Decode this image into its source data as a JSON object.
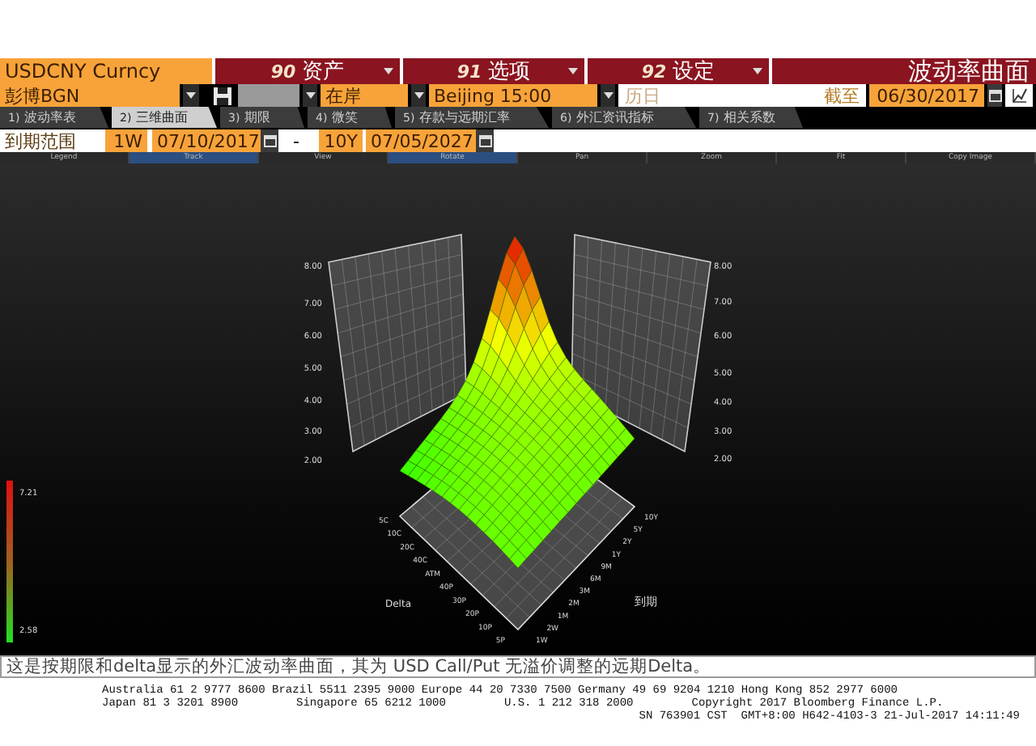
{
  "security": "USDCNY Curncy",
  "menus": [
    {
      "number": "90",
      "label": "资产"
    },
    {
      "number": "91",
      "label": "选项"
    },
    {
      "number": "92",
      "label": "设定"
    }
  ],
  "page_title": "波动率曲面",
  "settings": {
    "source": "彭博BGN",
    "market": "在岸",
    "time": "Beijing 15:00",
    "calendar": "历日",
    "as_of_label": "截至",
    "as_of_date": "06/30/2017"
  },
  "tabs": [
    {
      "number": "1)",
      "label": "波动率表",
      "selected": false
    },
    {
      "number": "2)",
      "label": "三维曲面",
      "selected": true
    },
    {
      "number": "3)",
      "label": "期限",
      "selected": false
    },
    {
      "number": "4)",
      "label": "微笑",
      "selected": false
    },
    {
      "number": "5)",
      "label": "存款与远期汇率",
      "selected": false
    },
    {
      "number": "6)",
      "label": "外汇资讯指标",
      "selected": false
    },
    {
      "number": "7)",
      "label": "相关系数",
      "selected": false
    }
  ],
  "expiry_range": {
    "label": "到期范围",
    "start_tenor": "1W",
    "start_date": "07/10/2017",
    "separator": "-",
    "end_tenor": "10Y",
    "end_date": "07/05/2027"
  },
  "toolbar": [
    {
      "label": "Legend",
      "selected": false
    },
    {
      "label": "Track",
      "selected": true
    },
    {
      "label": "View",
      "selected": false
    },
    {
      "label": "Rotate",
      "selected": true
    },
    {
      "label": "Pan",
      "selected": false
    },
    {
      "label": "Zoom",
      "selected": false
    },
    {
      "label": "Fit",
      "selected": false
    },
    {
      "label": "Copy Image",
      "selected": false
    }
  ],
  "chart": {
    "left_wall_ticks": [
      "8.00",
      "7.00",
      "6.00",
      "5.00",
      "4.00",
      "3.00",
      "2.00"
    ],
    "right_wall_ticks": [
      "8.00",
      "7.00",
      "6.00",
      "5.00",
      "4.00",
      "3.00",
      "2.00"
    ],
    "delta_ticks": [
      "5C",
      "10C",
      "20C",
      "40C",
      "ATM",
      "40P",
      "30P",
      "20P",
      "10P",
      "5P"
    ],
    "maturity_ticks": [
      "1W",
      "2W",
      "1M",
      "2M",
      "3M",
      "6M",
      "9M",
      "1Y",
      "2Y",
      "5Y",
      "10Y"
    ],
    "delta_title": "Delta",
    "maturity_title": "到期",
    "legend": {
      "max": "7.21",
      "min": "2.58"
    }
  },
  "description": "这是按期限和delta显示的外汇波动率曲面，其为 USD Call/Put 无溢价调整的远期Delta。",
  "footer": {
    "lines": [
      [
        "Australia 61 2 9777 8600 Brazil 5511 2395 9000 Europe 44 20 7330 7500 Germany 49 69 9204 1210 Hong Kong 852 2977 6000"
      ],
      [
        "Japan 81 3 3201 8900",
        "Singapore 65 6212 1000",
        "U.S. 1 212 318 2000",
        "Copyright 2017 Bloomberg Finance L.P."
      ],
      [
        "SN 763901 CST  GMT+8:00 H642-4103-3 21-Jul-2017 14:11:49"
      ]
    ]
  }
}
